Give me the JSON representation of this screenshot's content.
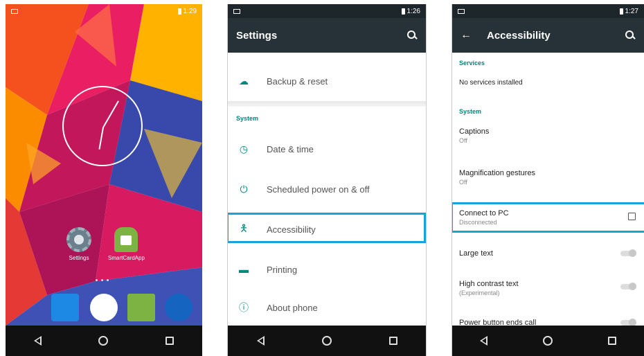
{
  "phone1": {
    "status_time": "1:29",
    "apps": [
      {
        "label": "Settings"
      },
      {
        "label": "SmartCardApp"
      }
    ]
  },
  "phone2": {
    "status_time": "1:26",
    "title": "Settings",
    "items": [
      {
        "label": "Backup & reset",
        "icon": "cloud-upload-icon"
      },
      {
        "label": "Date & time",
        "icon": "clock-icon"
      },
      {
        "label": "Scheduled power on & off",
        "icon": "power-icon"
      },
      {
        "label": "Accessibility",
        "icon": "accessibility-icon"
      },
      {
        "label": "Printing",
        "icon": "printer-icon"
      },
      {
        "label": "About phone",
        "icon": "info-icon"
      }
    ],
    "section_system": "System"
  },
  "phone3": {
    "status_time": "1:27",
    "title": "Accessibility",
    "section_services": "Services",
    "no_services": "No services installed",
    "section_system": "System",
    "prefs": [
      {
        "title": "Captions",
        "summary": "Off"
      },
      {
        "title": "Magnification gestures",
        "summary": "Off"
      },
      {
        "title": "Connect to PC",
        "summary": "Disconnected"
      },
      {
        "title": "Large text",
        "summary": ""
      },
      {
        "title": "High contrast text",
        "summary": "(Experimental)"
      },
      {
        "title": "Power button ends call",
        "summary": ""
      }
    ]
  },
  "colors": {
    "accent": "#00897b",
    "highlight": "#1aa3d9",
    "appbar": "#263238"
  }
}
